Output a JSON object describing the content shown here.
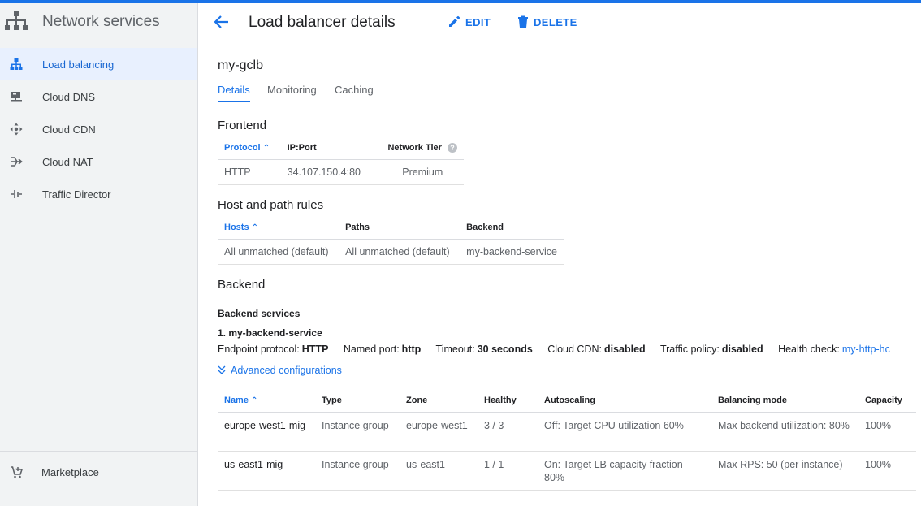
{
  "sidebar": {
    "title": "Network services",
    "items": [
      {
        "label": "Load balancing",
        "icon": "load-balancing-icon",
        "active": true
      },
      {
        "label": "Cloud DNS",
        "icon": "cloud-dns-icon"
      },
      {
        "label": "Cloud CDN",
        "icon": "cloud-cdn-icon"
      },
      {
        "label": "Cloud NAT",
        "icon": "cloud-nat-icon"
      },
      {
        "label": "Traffic Director",
        "icon": "traffic-director-icon"
      }
    ],
    "marketplace": "Marketplace"
  },
  "header": {
    "title": "Load balancer details",
    "edit_label": "EDIT",
    "delete_label": "DELETE"
  },
  "lb_name": "my-gclb",
  "tabs": [
    "Details",
    "Monitoring",
    "Caching"
  ],
  "frontend": {
    "title": "Frontend",
    "headers": [
      "Protocol",
      "IP:Port",
      "Network Tier"
    ],
    "rows": [
      [
        "HTTP",
        "34.107.150.4:80",
        "Premium"
      ]
    ]
  },
  "host_path": {
    "title": "Host and path rules",
    "headers": [
      "Hosts",
      "Paths",
      "Backend"
    ],
    "rows": [
      [
        "All unmatched (default)",
        "All unmatched (default)",
        "my-backend-service"
      ]
    ]
  },
  "backend": {
    "title": "Backend",
    "services_title": "Backend services",
    "service_name": "1. my-backend-service",
    "info": {
      "endpoint_k": "Endpoint protocol:",
      "endpoint_v": "HTTP",
      "port_k": "Named port:",
      "port_v": "http",
      "timeout_k": "Timeout:",
      "timeout_v": "30 seconds",
      "cdn_k": "Cloud CDN:",
      "cdn_v": "disabled",
      "traffic_k": "Traffic policy:",
      "traffic_v": "disabled",
      "health_k": "Health check:",
      "health_v": "my-http-hc"
    },
    "advanced_label": "Advanced configurations",
    "headers": [
      "Name",
      "Type",
      "Zone",
      "Healthy",
      "Autoscaling",
      "Balancing mode",
      "Capacity"
    ],
    "rows": [
      [
        "europe-west1-mig",
        "Instance group",
        "europe-west1",
        "3 / 3",
        "Off: Target CPU utilization 60%",
        "Max backend utilization: 80%",
        "100%"
      ],
      [
        "us-east1-mig",
        "Instance group",
        "us-east1",
        "1 / 1",
        "On: Target LB capacity fraction 80%",
        "Max RPS: 50 (per instance)",
        "100%"
      ]
    ]
  },
  "colors": {
    "accent": "#1a73e8",
    "sidebar_bg": "#f1f3f4",
    "active_bg": "#e8f0fe"
  }
}
